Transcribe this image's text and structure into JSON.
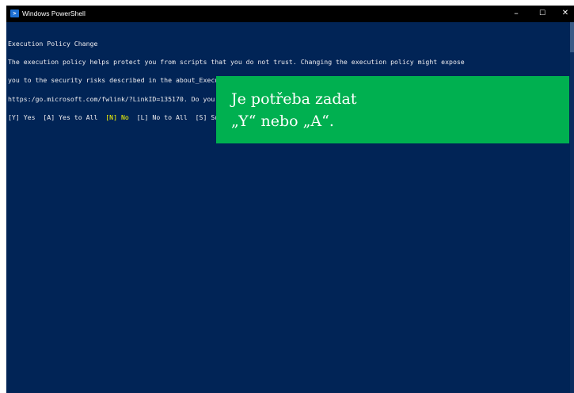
{
  "window": {
    "title": "Windows PowerShell",
    "icon": "powershell-icon",
    "controls": {
      "minimize": "–",
      "maximize": "☐",
      "close": "✕"
    }
  },
  "console": {
    "heading": "Execution Policy Change",
    "lines": [
      "The execution policy helps protect you from scripts that you do not trust. Changing the execution policy might expose",
      "you to the security risks described in the about_Execution_Policies help topic at",
      "https:/go.microsoft.com/fwlink/?LinkID=135170. Do you want to change the execution policy?"
    ],
    "prompt": {
      "opt_yes": "[Y] Yes  [A] Yes to All  ",
      "opt_no": "[N] No",
      "opt_rest": "  [L] No to All  [S] Suspend  [?] Help (default is \"N\"): "
    },
    "colors": {
      "background": "#012456",
      "text": "#eeedf0",
      "highlight": "#ffff00"
    }
  },
  "callout": {
    "line1": "Je potřeba zadat",
    "line2": "„Y“ nebo „A“.",
    "color": "#00b050"
  }
}
